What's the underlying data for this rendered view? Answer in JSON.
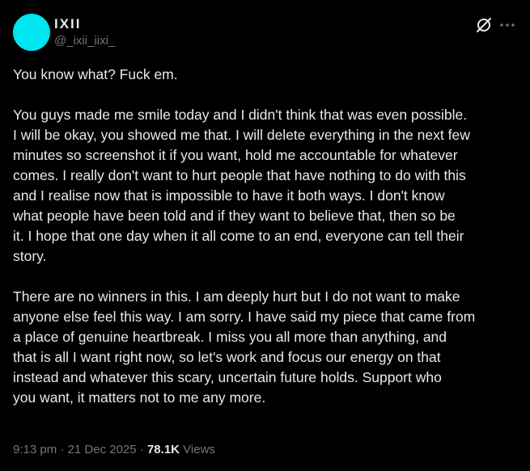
{
  "author": {
    "display_name": "IXII",
    "handle": "@_ixii_iixi_",
    "avatar_color": "#00e5ee"
  },
  "icons": {
    "grok": "grok-icon",
    "more": "more-icon"
  },
  "post": {
    "lines": [
      "You know what? Fuck em.",
      "",
      "You guys made me smile today and I didn't think that was even possible.",
      "I will be okay, you showed me that. I will delete everything in the next few",
      "minutes so screenshot it if you want, hold me accountable for whatever",
      "comes. I really don't want to hurt people that have nothing to do with this",
      "and I realise now that is impossible to have it both ways. I don't know",
      "what people have been told and if they want to believe that, then so be",
      "it. I hope that one day when it all come to an end, everyone can tell their",
      "story.",
      "",
      "There are no winners in this. I am deeply hurt but I do not want to make",
      "anyone else feel this way. I am sorry. I have said my piece that came from",
      "a place of genuine heartbreak. I miss you all more than anything, and",
      "that is all I want right now, so let's work and focus our energy on that",
      "instead and whatever this scary, uncertain future holds. Support who",
      "you want, it matters not to me any more."
    ]
  },
  "meta": {
    "time": "9:13 pm",
    "separator": "·",
    "date": "21 Dec 2025",
    "views_count": "78.1K",
    "views_label": "Views"
  }
}
